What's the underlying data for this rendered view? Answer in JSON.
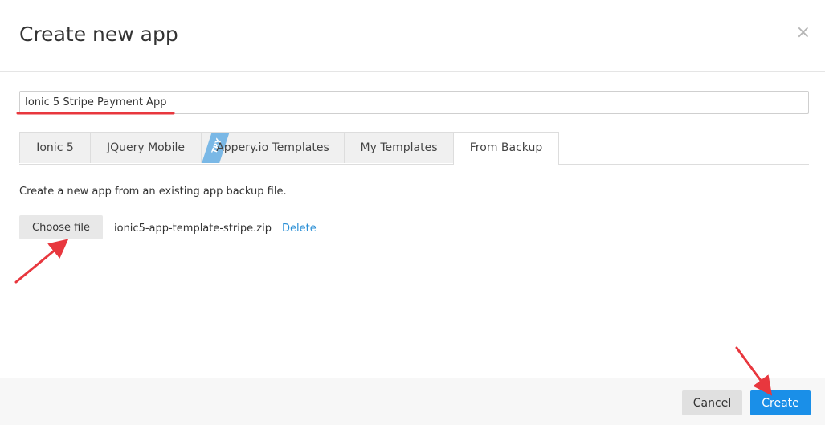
{
  "dialog": {
    "title": "Create new app",
    "close_glyph": "×"
  },
  "app_name_input": {
    "value": "Ionic 5 Stripe Payment App"
  },
  "tabs": [
    {
      "label": "Ionic 5",
      "active": false
    },
    {
      "label": "JQuery Mobile",
      "active": false
    },
    {
      "label": "Appery.io Templates",
      "active": false,
      "badge": "TRY"
    },
    {
      "label": "My Templates",
      "active": false
    },
    {
      "label": "From Backup",
      "active": true
    }
  ],
  "backup": {
    "description": "Create a new app from an existing app backup file.",
    "choose_file_label": "Choose file",
    "file_name": "ionic5-app-template-stripe.zip",
    "delete_label": "Delete"
  },
  "footer": {
    "cancel_label": "Cancel",
    "create_label": "Create"
  },
  "colors": {
    "primary": "#1a8fe8",
    "link": "#2a8fd6",
    "annotation": "#e8373e",
    "try_ribbon": "#7ab8e6"
  },
  "icons": {
    "close": "close-icon"
  }
}
